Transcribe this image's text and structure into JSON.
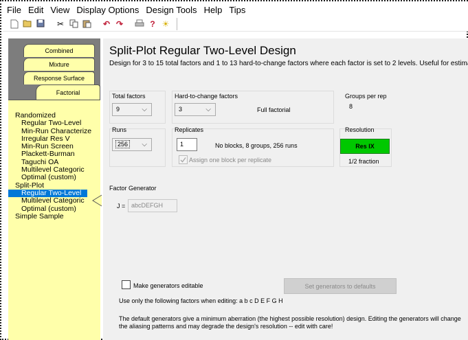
{
  "menubar": {
    "items": [
      "File",
      "Edit",
      "View",
      "Display Options",
      "Design Tools",
      "Help",
      "Tips"
    ]
  },
  "toolbar": {
    "icons": [
      "new-file-icon",
      "open-folder-icon",
      "save-icon",
      "cut-icon",
      "copy-icon",
      "paste-icon",
      "undo-icon",
      "redo-icon",
      "print-icon",
      "help-icon",
      "tip-bulb-icon"
    ]
  },
  "sidebar": {
    "tabs": {
      "combined": "Combined",
      "mixture": "Mixture",
      "response_surface": "Response Surface",
      "factorial": "Factorial"
    },
    "tree": [
      "Randomized",
      "Regular Two-Level",
      "Min-Run Characterize",
      "Irregular Res V",
      "Min-Run Screen",
      "Plackett-Burman",
      "Taguchi OA",
      "Multilevel Categoric",
      "Optimal (custom)",
      "Split-Plot",
      "Regular Two-Level",
      "Multilevel Categoric",
      "Optimal (custom)",
      "Simple Sample"
    ]
  },
  "main": {
    "title": "Split-Plot Regular Two-Level Design",
    "subtitle": "Design for 3 to 15 total factors and 1 to 13 hard-to-change factors where each factor is set to 2 levels. Useful for estimat",
    "total_factors": {
      "label": "Total factors",
      "value": "9"
    },
    "htc_factors": {
      "label": "Hard-to-change factors",
      "value": "3",
      "note": "Full factorial"
    },
    "groups_per_rep": {
      "label": "Groups per rep",
      "value": "8"
    },
    "runs": {
      "label": "Runs",
      "value": "256"
    },
    "replicates": {
      "label": "Replicates",
      "value": "1",
      "note": "No blocks, 8 groups, 256 runs",
      "checkbox_label": "Assign one block per replicate"
    },
    "resolution": {
      "label": "Resolution",
      "value": "Res IX",
      "fraction": "1/2 fraction"
    },
    "factor_generator": {
      "label": "Factor Generator",
      "name": "J =",
      "value": "abcDEFGH"
    },
    "editable_checkbox_label": "Make generators editable",
    "defaults_button": "Set generators to defaults",
    "editing_hint": "Use only the following factors when editing: a b c D E F G H",
    "warning_text": "The default generators give a minimum aberration (the highest possible resolution) design. Editing the generators will change the aliasing patterns and may degrade the design's resolution  -- edit with care!"
  },
  "colors": {
    "tree_background": "#ffffaa",
    "selection": "#0078d7",
    "resolution_green": "#00c800",
    "sidebar_gray": "#7d7d7d"
  }
}
